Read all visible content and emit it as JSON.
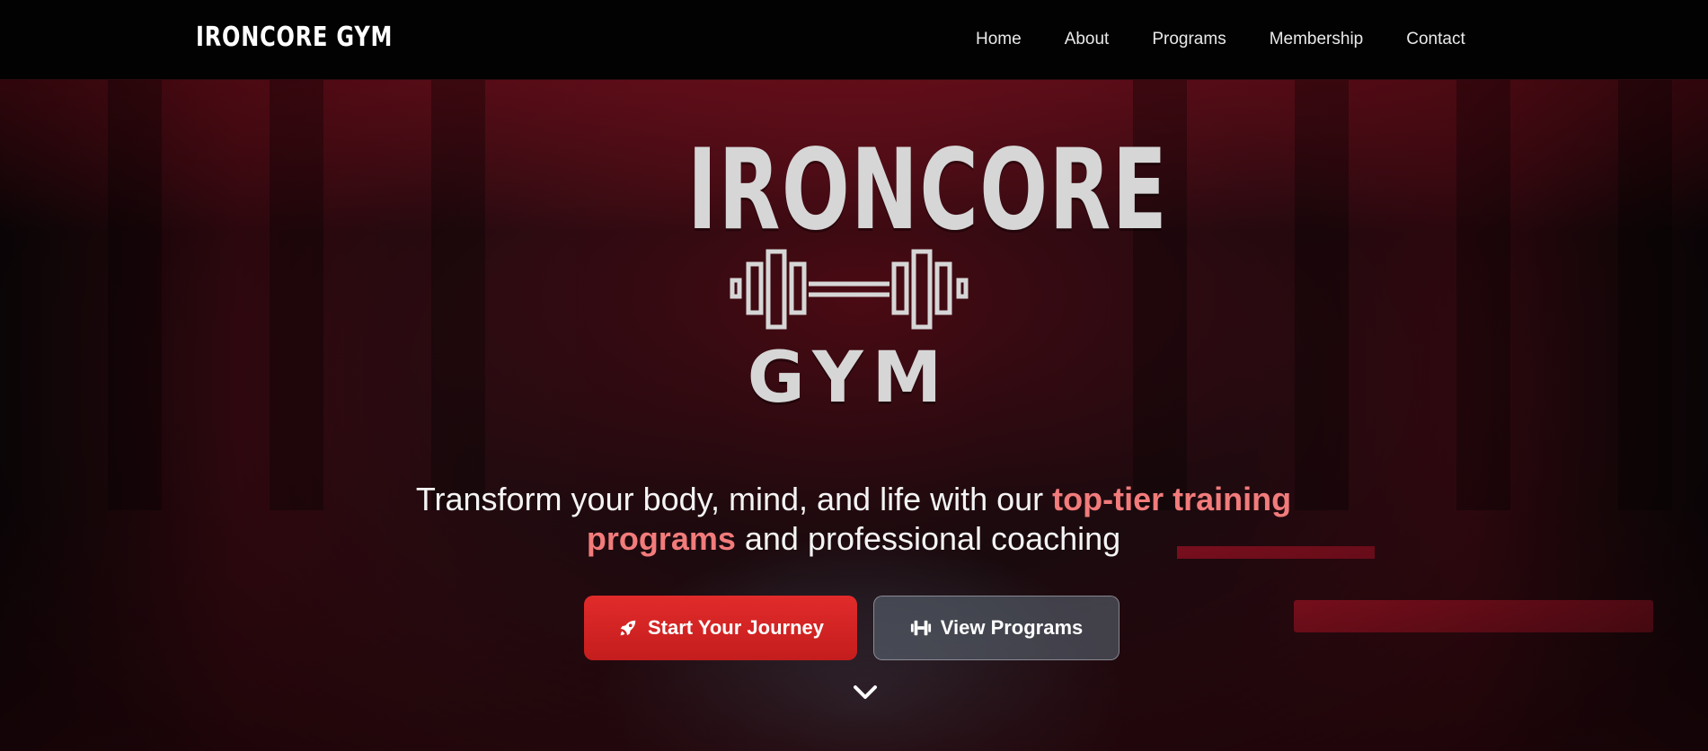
{
  "nav": {
    "brand": "IRONCORE GYM",
    "links": [
      "Home",
      "About",
      "Programs",
      "Membership",
      "Contact"
    ]
  },
  "logo": {
    "word_top": "IRONCORE",
    "word_bottom": "GYM"
  },
  "hero": {
    "tagline_part1": "Transform your body, mind, and life with our ",
    "tagline_highlight": "top-tier training programs",
    "tagline_part2": " and professional coaching"
  },
  "buttons": {
    "primary_label": "Start Your Journey",
    "primary_icon": "rocket-icon",
    "secondary_label": "View Programs",
    "secondary_icon": "dumbbell-icon"
  },
  "colors": {
    "accent": "#d42424",
    "highlight": "#f27b7b",
    "nav_bg": "#020202"
  },
  "scroll_indicator_icon": "chevron-down-icon"
}
